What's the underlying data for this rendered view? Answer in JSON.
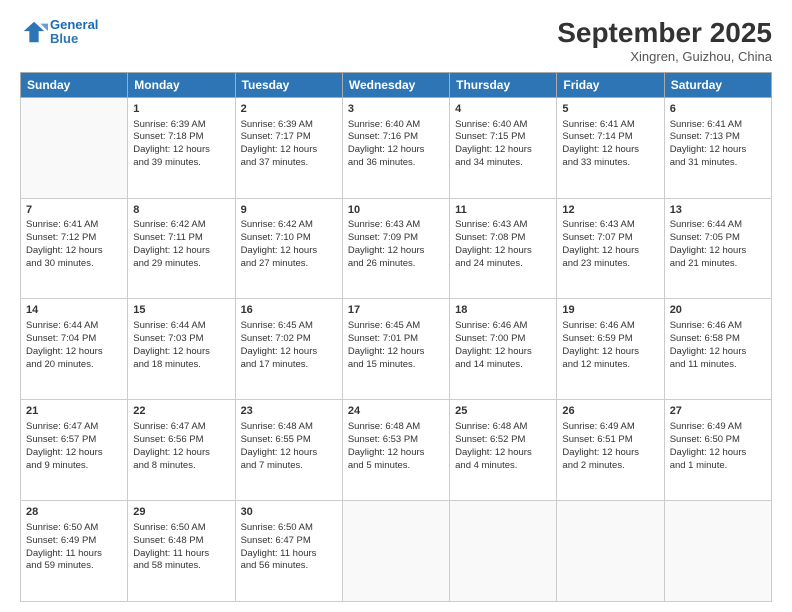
{
  "logo": {
    "line1": "General",
    "line2": "Blue"
  },
  "title": "September 2025",
  "location": "Xingren, Guizhou, China",
  "days_of_week": [
    "Sunday",
    "Monday",
    "Tuesday",
    "Wednesday",
    "Thursday",
    "Friday",
    "Saturday"
  ],
  "weeks": [
    [
      {
        "day": "",
        "text": ""
      },
      {
        "day": "1",
        "text": "Sunrise: 6:39 AM\nSunset: 7:18 PM\nDaylight: 12 hours\nand 39 minutes."
      },
      {
        "day": "2",
        "text": "Sunrise: 6:39 AM\nSunset: 7:17 PM\nDaylight: 12 hours\nand 37 minutes."
      },
      {
        "day": "3",
        "text": "Sunrise: 6:40 AM\nSunset: 7:16 PM\nDaylight: 12 hours\nand 36 minutes."
      },
      {
        "day": "4",
        "text": "Sunrise: 6:40 AM\nSunset: 7:15 PM\nDaylight: 12 hours\nand 34 minutes."
      },
      {
        "day": "5",
        "text": "Sunrise: 6:41 AM\nSunset: 7:14 PM\nDaylight: 12 hours\nand 33 minutes."
      },
      {
        "day": "6",
        "text": "Sunrise: 6:41 AM\nSunset: 7:13 PM\nDaylight: 12 hours\nand 31 minutes."
      }
    ],
    [
      {
        "day": "7",
        "text": "Sunrise: 6:41 AM\nSunset: 7:12 PM\nDaylight: 12 hours\nand 30 minutes."
      },
      {
        "day": "8",
        "text": "Sunrise: 6:42 AM\nSunset: 7:11 PM\nDaylight: 12 hours\nand 29 minutes."
      },
      {
        "day": "9",
        "text": "Sunrise: 6:42 AM\nSunset: 7:10 PM\nDaylight: 12 hours\nand 27 minutes."
      },
      {
        "day": "10",
        "text": "Sunrise: 6:43 AM\nSunset: 7:09 PM\nDaylight: 12 hours\nand 26 minutes."
      },
      {
        "day": "11",
        "text": "Sunrise: 6:43 AM\nSunset: 7:08 PM\nDaylight: 12 hours\nand 24 minutes."
      },
      {
        "day": "12",
        "text": "Sunrise: 6:43 AM\nSunset: 7:07 PM\nDaylight: 12 hours\nand 23 minutes."
      },
      {
        "day": "13",
        "text": "Sunrise: 6:44 AM\nSunset: 7:05 PM\nDaylight: 12 hours\nand 21 minutes."
      }
    ],
    [
      {
        "day": "14",
        "text": "Sunrise: 6:44 AM\nSunset: 7:04 PM\nDaylight: 12 hours\nand 20 minutes."
      },
      {
        "day": "15",
        "text": "Sunrise: 6:44 AM\nSunset: 7:03 PM\nDaylight: 12 hours\nand 18 minutes."
      },
      {
        "day": "16",
        "text": "Sunrise: 6:45 AM\nSunset: 7:02 PM\nDaylight: 12 hours\nand 17 minutes."
      },
      {
        "day": "17",
        "text": "Sunrise: 6:45 AM\nSunset: 7:01 PM\nDaylight: 12 hours\nand 15 minutes."
      },
      {
        "day": "18",
        "text": "Sunrise: 6:46 AM\nSunset: 7:00 PM\nDaylight: 12 hours\nand 14 minutes."
      },
      {
        "day": "19",
        "text": "Sunrise: 6:46 AM\nSunset: 6:59 PM\nDaylight: 12 hours\nand 12 minutes."
      },
      {
        "day": "20",
        "text": "Sunrise: 6:46 AM\nSunset: 6:58 PM\nDaylight: 12 hours\nand 11 minutes."
      }
    ],
    [
      {
        "day": "21",
        "text": "Sunrise: 6:47 AM\nSunset: 6:57 PM\nDaylight: 12 hours\nand 9 minutes."
      },
      {
        "day": "22",
        "text": "Sunrise: 6:47 AM\nSunset: 6:56 PM\nDaylight: 12 hours\nand 8 minutes."
      },
      {
        "day": "23",
        "text": "Sunrise: 6:48 AM\nSunset: 6:55 PM\nDaylight: 12 hours\nand 7 minutes."
      },
      {
        "day": "24",
        "text": "Sunrise: 6:48 AM\nSunset: 6:53 PM\nDaylight: 12 hours\nand 5 minutes."
      },
      {
        "day": "25",
        "text": "Sunrise: 6:48 AM\nSunset: 6:52 PM\nDaylight: 12 hours\nand 4 minutes."
      },
      {
        "day": "26",
        "text": "Sunrise: 6:49 AM\nSunset: 6:51 PM\nDaylight: 12 hours\nand 2 minutes."
      },
      {
        "day": "27",
        "text": "Sunrise: 6:49 AM\nSunset: 6:50 PM\nDaylight: 12 hours\nand 1 minute."
      }
    ],
    [
      {
        "day": "28",
        "text": "Sunrise: 6:50 AM\nSunset: 6:49 PM\nDaylight: 11 hours\nand 59 minutes."
      },
      {
        "day": "29",
        "text": "Sunrise: 6:50 AM\nSunset: 6:48 PM\nDaylight: 11 hours\nand 58 minutes."
      },
      {
        "day": "30",
        "text": "Sunrise: 6:50 AM\nSunset: 6:47 PM\nDaylight: 11 hours\nand 56 minutes."
      },
      {
        "day": "",
        "text": ""
      },
      {
        "day": "",
        "text": ""
      },
      {
        "day": "",
        "text": ""
      },
      {
        "day": "",
        "text": ""
      }
    ]
  ]
}
